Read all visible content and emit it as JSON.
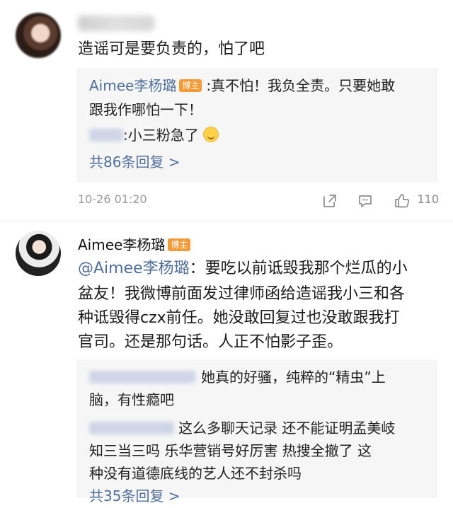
{
  "comment1": {
    "avatar": "avatar-blurred",
    "text": "造谣可是要负责的，怕了吧",
    "reply_box": {
      "reply1_author": "Aimee李杨璐",
      "reply1_badge": "博主",
      "reply1_text_line1": ":真不怕！我负全责。只要她敢",
      "reply1_text_line2": "跟我作哪怕一下！",
      "reply2_text": ":小三粉急了",
      "reply2_emoji": "smile-emoji",
      "more_replies": "共86条回复 >"
    },
    "meta": {
      "timestamp": "10-26 01:20",
      "likes": "110",
      "icons": [
        "share-icon",
        "comment-icon",
        "like-icon"
      ]
    }
  },
  "comment2": {
    "author": "Aimee李杨璐",
    "badge": "博主",
    "text_line1_mention": "@Aimee李杨璐",
    "text_line1_rest": "：要吃以前诋毁我那个烂瓜的小",
    "text_line2": "盆友！我微博前面发过律师函给造谣我小三和各",
    "text_line3": "种诋毁得czx前任。她没敢回复过也没敢跟我打",
    "text_line4": "官司。还是那句话。人正不怕影子歪。",
    "reply_box": {
      "reply1_text_line1": "她真的好骚，纯粹的“精虫”上",
      "reply1_text_line2": "脑，有性瘾吧",
      "reply2_text_line1": "这么多聊天记录 还不能证明孟美岐",
      "reply2_text_line2": "知三当三吗 乐华营销号好厉害 热搜全撤了  这",
      "reply2_text_line3": "种没有道德底线的艺人还不封杀吗",
      "more_replies": "共35条回复 >"
    }
  },
  "colors": {
    "link_blue": "#4f6e9a",
    "badge_orange": "#f29b38",
    "reply_bg": "#f6f6f6",
    "meta_gray": "#9a9a9a"
  }
}
